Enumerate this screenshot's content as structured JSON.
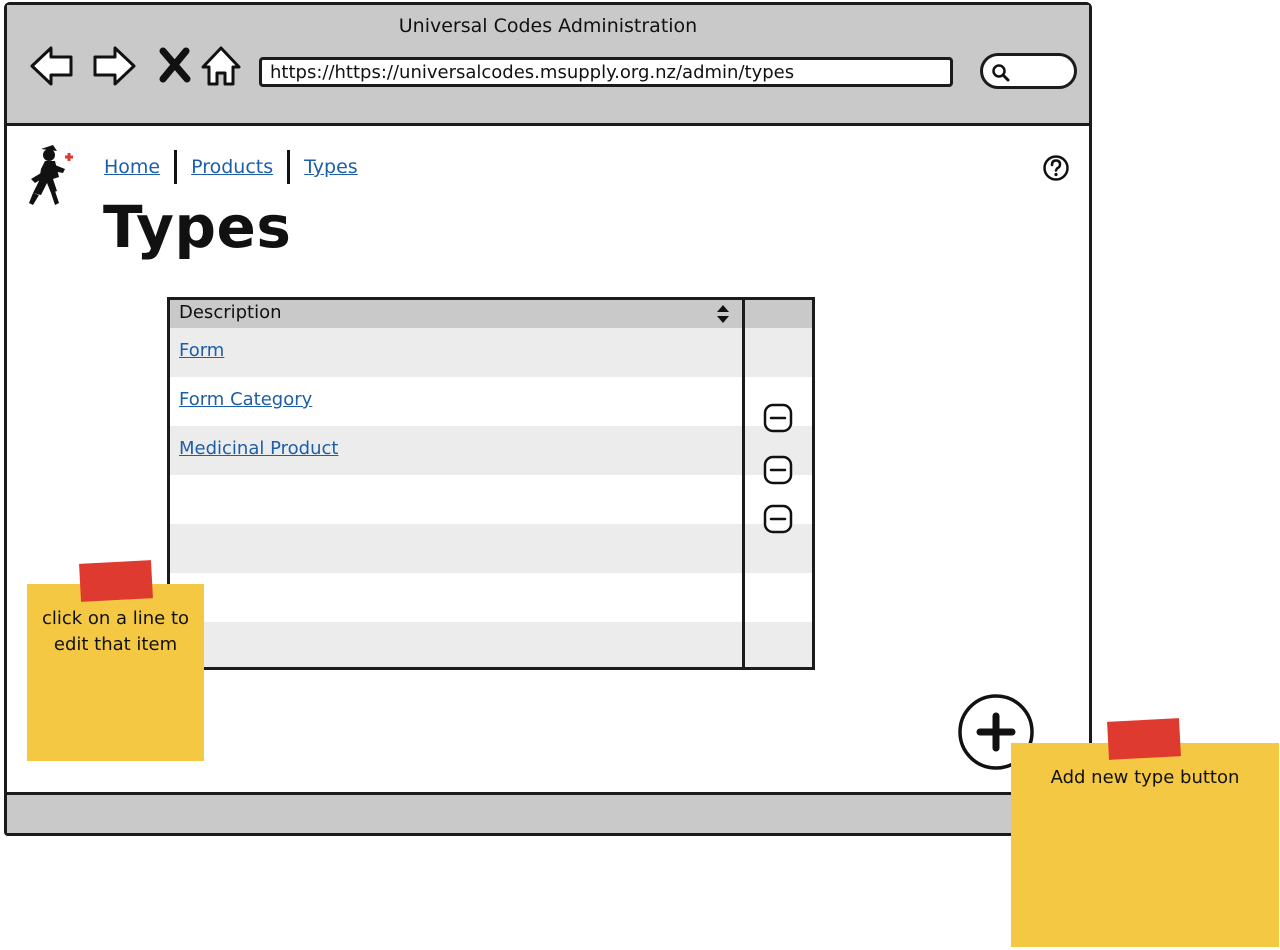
{
  "window": {
    "title": "Universal Codes Administration",
    "url": "https://https://universalcodes.msupply.org.nz/admin/types"
  },
  "nav_icons": [
    "back-icon",
    "forward-icon",
    "stop-icon",
    "home-icon"
  ],
  "breadcrumb": {
    "items": [
      "Home",
      "Products",
      "Types"
    ]
  },
  "page": {
    "title": "Types"
  },
  "table": {
    "header": "Description",
    "rows": [
      "Form",
      "Form Category",
      "Medicinal Product",
      "",
      "",
      "",
      ""
    ],
    "remove_buttons": 3
  },
  "notes": {
    "left": "click on a line to edit that item",
    "right": "Add new type button"
  },
  "colors": {
    "chrome": "#c9c9c9",
    "link": "#1d5ea8",
    "row_shade": "#ececec",
    "sticky": "#f4c842",
    "tape": "#de3a2f"
  }
}
